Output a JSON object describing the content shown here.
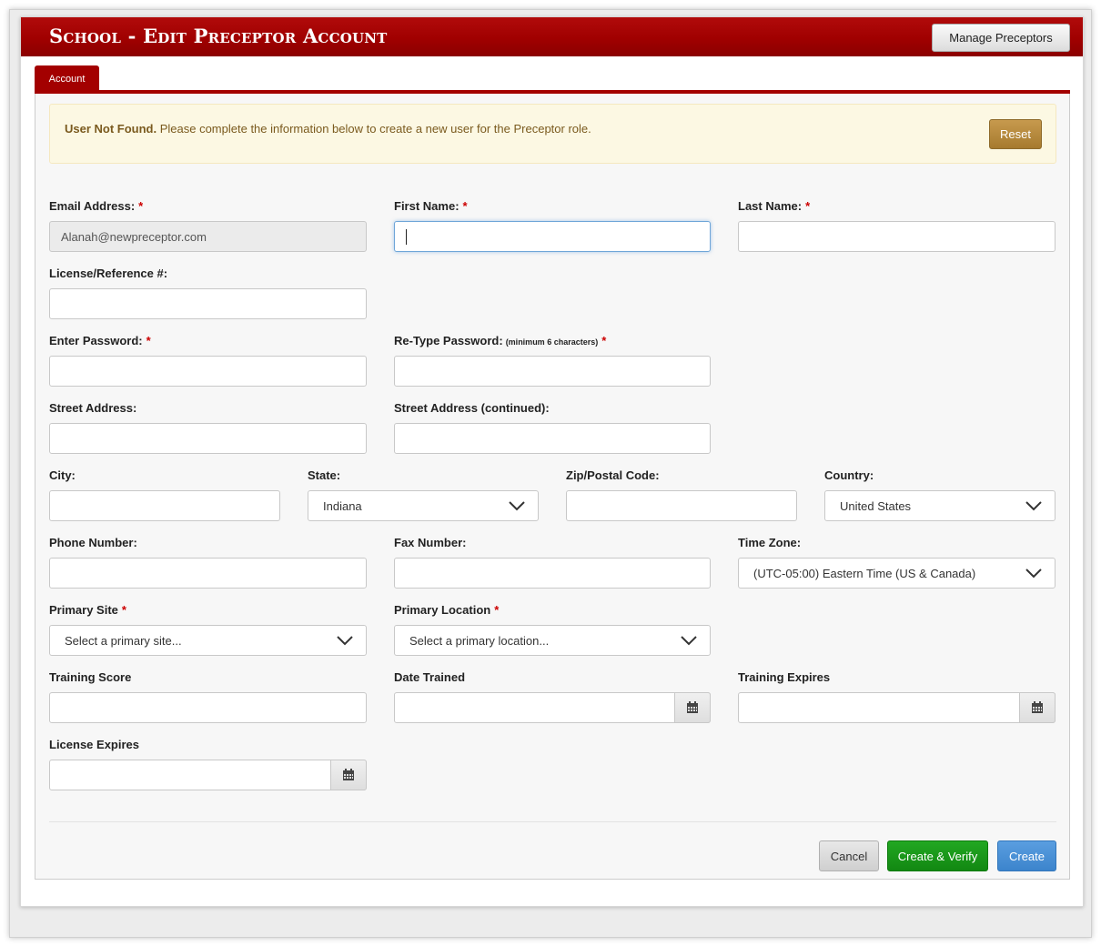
{
  "header": {
    "title": "School - Edit Preceptor Account",
    "manage_button": "Manage Preceptors"
  },
  "tabs": [
    {
      "label": "Account",
      "active": true
    }
  ],
  "alert": {
    "strong": "User Not Found.",
    "message": " Please complete the information below to create a new user for the Preceptor role.",
    "reset_button": "Reset"
  },
  "form": {
    "email": {
      "label": "Email Address:",
      "value": "Alanah@newpreceptor.com",
      "required": true
    },
    "first_name": {
      "label": "First Name:",
      "value": "",
      "required": true
    },
    "last_name": {
      "label": "Last Name:",
      "value": "",
      "required": true
    },
    "license_ref": {
      "label": "License/Reference #:",
      "value": ""
    },
    "password": {
      "label": "Enter Password:",
      "value": "",
      "required": true
    },
    "retype_password": {
      "label": "Re-Type Password:",
      "hint": "(minimum 6 characters)",
      "value": "",
      "required": true
    },
    "street": {
      "label": "Street Address:",
      "value": ""
    },
    "street2": {
      "label": "Street Address (continued):",
      "value": ""
    },
    "city": {
      "label": "City:",
      "value": ""
    },
    "state": {
      "label": "State:",
      "selected": "Indiana"
    },
    "zip": {
      "label": "Zip/Postal Code:",
      "value": ""
    },
    "country": {
      "label": "Country:",
      "selected": "United States"
    },
    "phone": {
      "label": "Phone Number:",
      "value": ""
    },
    "fax": {
      "label": "Fax Number:",
      "value": ""
    },
    "timezone": {
      "label": "Time Zone:",
      "selected": "(UTC-05:00) Eastern Time (US & Canada)"
    },
    "primary_site": {
      "label": "Primary Site",
      "placeholder": "Select a primary site...",
      "required": true
    },
    "primary_location": {
      "label": "Primary Location",
      "placeholder": "Select a primary location...",
      "required": true
    },
    "training_score": {
      "label": "Training Score",
      "value": ""
    },
    "date_trained": {
      "label": "Date Trained",
      "value": ""
    },
    "training_expires": {
      "label": "Training Expires",
      "value": ""
    },
    "license_expires": {
      "label": "License Expires",
      "value": ""
    }
  },
  "required_marker": "*",
  "actions": {
    "cancel": "Cancel",
    "create_verify": "Create & Verify",
    "create": "Create"
  },
  "colors": {
    "title_bar": "#a30000",
    "alert_bg": "#fcf8e3",
    "reset": "#b88a3e",
    "verify": "#1a9a1a",
    "create": "#4a90d9"
  }
}
